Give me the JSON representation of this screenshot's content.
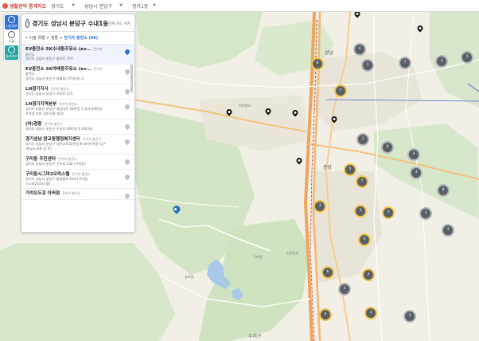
{
  "header": {
    "app_title": "생활권역 통계지도",
    "region1": "경기도",
    "region2": "성남시 분당구",
    "region3": "정자1동"
  },
  "rail": {
    "btn1": "시설정보",
    "btn2": "도움",
    "btn3": "통계정보"
  },
  "panel": {
    "title": "경기도 성남시 분당구 수내1동",
    "link": "현재 지도 위치",
    "crumb_prefix": "• 시설 유형 >",
    "crumb_mid": "생활 >",
    "crumb_current": "전기차 충전소 (66)"
  },
  "facilities": [
    {
      "name": "EV충전소 SK수내동주유소 (ev…",
      "tag": "전기차",
      "line1": "충전소",
      "line2": "경기도 성남시 분당구 돌마로 274"
    },
    {
      "name": "EV충전소 SK야베동주유소 (ev…",
      "tag": "전기차",
      "line1": "충전소",
      "line2": "경기도 성남시 분당구 야베동(771번지) 2"
    },
    {
      "name": "LH경기지사",
      "tag": "전기차 충전소",
      "line1": "",
      "line2": "경기도 성남시 분당구 구미로 175"
    },
    {
      "name": "LH경기지역본부",
      "tag": "전기차 충전소",
      "line1": "경기도 성남시 분당구 성남대로 54번길 3 경기지역본부",
      "line2": "주차장 지하 1층(신흥 빌딩)"
    },
    {
      "name": "(바)경동",
      "tag": "전기차 충전소",
      "line1": "",
      "line2": "경기도 성남시 분당구 수내로 46번길 4 지하1층"
    },
    {
      "name": "경기성남 판교동행정복지센터",
      "tag": "전기차 충전소",
      "line1": "경기도 성남시 분당구 서판교로32번길 8 지하주차장 입구",
      "line2": "(판교도서관 앞 쪽)"
    },
    {
      "name": "구미동 주민센터",
      "tag": "전기차 충전소",
      "line1": "",
      "line2": "경기도 성남시 분당구 구미로 132 (구미동)"
    },
    {
      "name": "구미동시그마2오피스텔",
      "tag": "전기차 충전소",
      "line1": "경기도 성남시 분당구 황새울로 104 (구미동,",
      "line2": "시그마2오피스텔)"
    },
    {
      "name": "가야오도큐 아퍼점",
      "tag": "전기차 충전소",
      "line1": "",
      "line2": ""
    }
  ],
  "map_labels": {
    "seongnam": "성남",
    "jiriam": "지적청사",
    "bundang": "분당",
    "sujigu": "수지구",
    "guro": "구미동",
    "sinbundang": "신분당선",
    "golf": "골프장"
  },
  "clusters": [
    "8",
    "4",
    "3",
    "7",
    "3",
    "5",
    "7",
    "3",
    "8",
    "4",
    "5",
    "3",
    "7",
    "8",
    "3",
    "3",
    "3",
    "3",
    "5",
    "3",
    "6",
    "3",
    "3",
    "4",
    "3",
    "3"
  ]
}
